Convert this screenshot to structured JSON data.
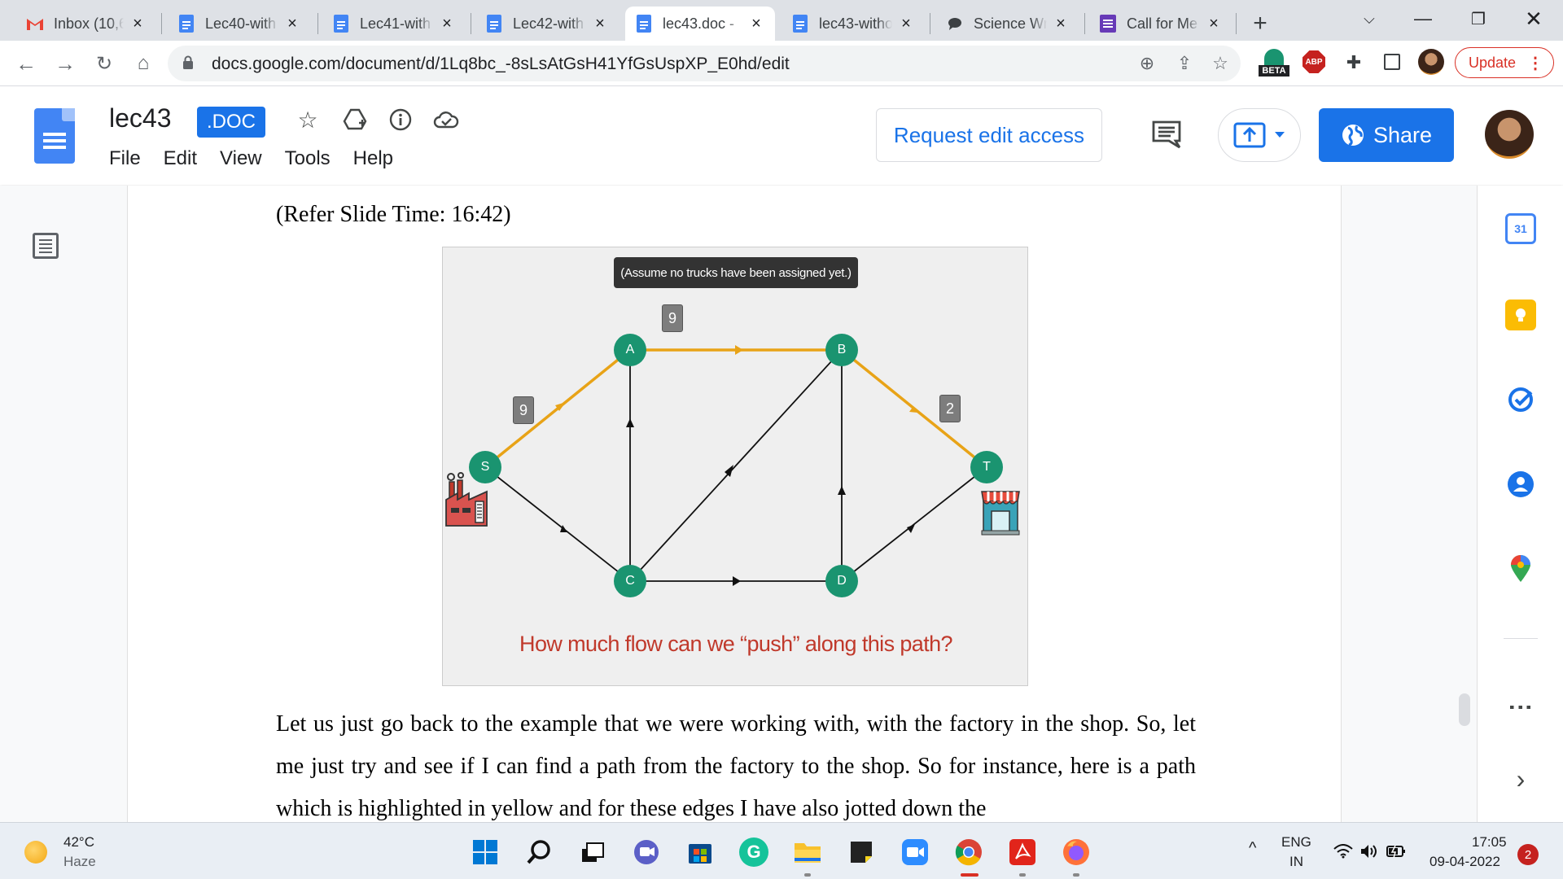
{
  "browser": {
    "tabs": [
      {
        "title": "Inbox (10,6",
        "favicon": "gmail-icon",
        "active": false
      },
      {
        "title": "Lec40-with",
        "favicon": "docs-icon",
        "active": false
      },
      {
        "title": "Lec41-with",
        "favicon": "docs-icon",
        "active": false
      },
      {
        "title": "Lec42-with",
        "favicon": "docs-icon",
        "active": false
      },
      {
        "title": "lec43.doc -",
        "favicon": "docs-icon",
        "active": true
      },
      {
        "title": "lec43-witho",
        "favicon": "docs-icon",
        "active": false
      },
      {
        "title": "Science Wri",
        "favicon": "chat-icon",
        "active": false
      },
      {
        "title": "Call for Me",
        "favicon": "forms-icon",
        "active": false
      }
    ],
    "new_tab": "+",
    "url": "docs.google.com/document/d/1Lq8bc_-8sLsAtGsH41YfGsUspXP_E0hd/edit",
    "extension_beta": "BETA",
    "extension_abp": "ABP",
    "update_label": "Update"
  },
  "docs": {
    "title": "lec43",
    "badge": ".DOC",
    "menu": [
      "File",
      "Edit",
      "View",
      "Tools",
      "Help"
    ],
    "request_edit": "Request edit access",
    "share": "Share"
  },
  "document": {
    "slide_time": "(Refer Slide Time: 16:42)",
    "paragraph": "Let us just go back to the example that we were working with, with the factory in the shop. So, let me just try and see if I can find a path from the factory to the shop. So for instance, here is a path which is highlighted in yellow and for these edges I have also jotted down the"
  },
  "slide": {
    "note": "(Assume no trucks have been assigned yet.)",
    "question": "How much flow can we “push” along this path?",
    "nodes": [
      {
        "id": "S"
      },
      {
        "id": "A"
      },
      {
        "id": "B"
      },
      {
        "id": "C"
      },
      {
        "id": "D"
      },
      {
        "id": "T"
      }
    ],
    "edge_labels": [
      {
        "edge": "S-A",
        "label": "9"
      },
      {
        "edge": "A-B",
        "label": "9"
      },
      {
        "edge": "B-T",
        "label": "2"
      }
    ],
    "highlight_color": "#e8a317",
    "node_color": "#1a9470",
    "question_color": "#c0392b"
  },
  "sidepanel": {
    "calendar_day": "31",
    "more": "⋮",
    "expand": "›"
  },
  "taskbar": {
    "temperature": "42°C",
    "weather": "Haze",
    "lang_top": "ENG",
    "lang_bottom": "IN",
    "time": "17:05",
    "date": "09-04-2022",
    "notifications": "2"
  }
}
